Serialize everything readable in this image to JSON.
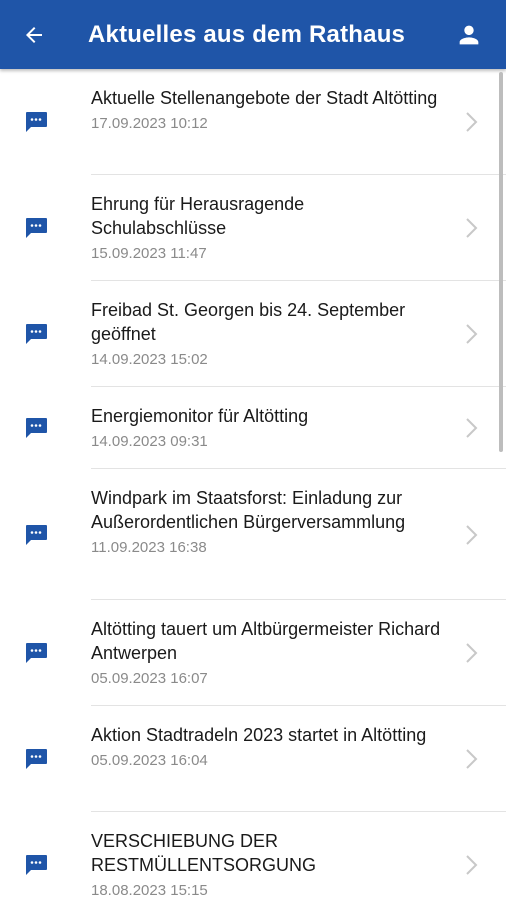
{
  "header": {
    "title": "Aktuelles aus dem Rathaus",
    "back_icon": "arrow-left-icon",
    "profile_icon": "person-icon",
    "bg_color": "#1f55a8"
  },
  "items": [
    {
      "title": "Aktuelle Stellenangebote der Stadt Altötting",
      "date": "17.09.2023 10:12"
    },
    {
      "title": "Ehrung für Herausragende Schulabschlüsse",
      "date": "15.09.2023 11:47"
    },
    {
      "title": "Freibad St. Georgen bis 24. September geöffnet",
      "date": "14.09.2023 15:02"
    },
    {
      "title": "Energiemonitor für Altötting",
      "date": "14.09.2023 09:31"
    },
    {
      "title": "Windpark im Staatsforst: Einladung zur Außerordentlichen Bürgerversammlung",
      "date": "11.09.2023 16:38"
    },
    {
      "title": "Altötting tauert um Altbürgermeister Richard Antwerpen",
      "date": "05.09.2023 16:07"
    },
    {
      "title": "Aktion Stadtradeln 2023 startet in Altötting",
      "date": "05.09.2023 16:04"
    },
    {
      "title": "VERSCHIEBUNG DER RESTMÜLLENTSORGUNG",
      "date": "18.08.2023 15:15"
    }
  ],
  "item_icon": "message-bubble-icon",
  "accent_color": "#1f55a8"
}
